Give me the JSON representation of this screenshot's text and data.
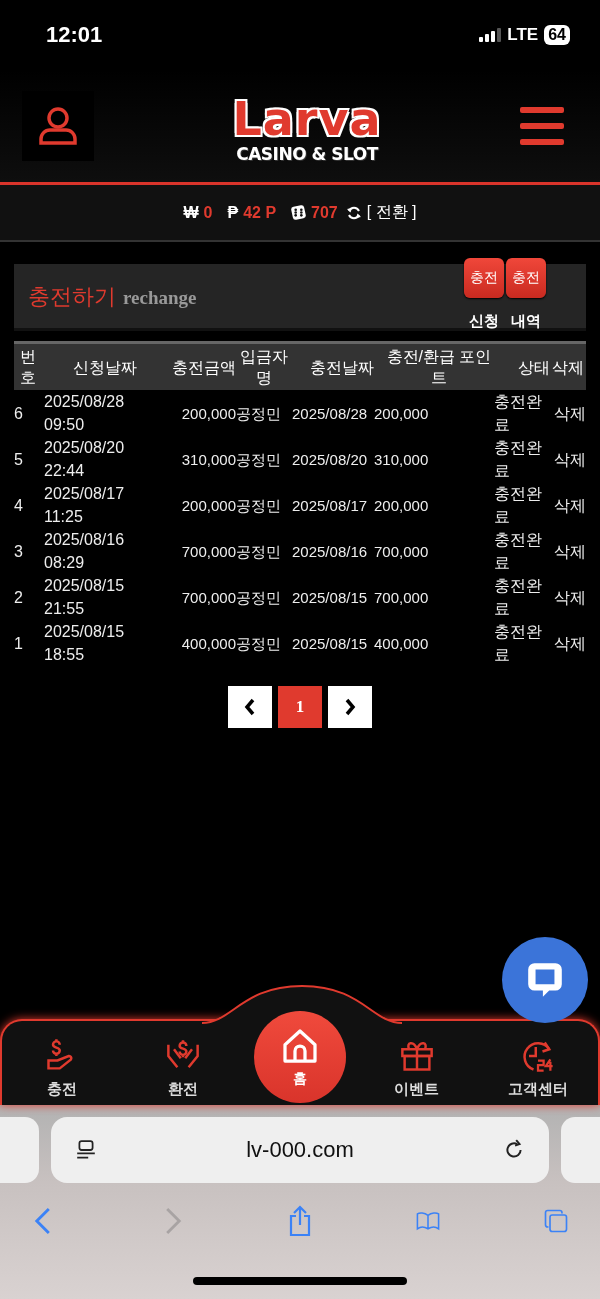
{
  "status_bar": {
    "time": "12:01",
    "network": "LTE",
    "battery": "64"
  },
  "header": {
    "logo": {
      "title": "Larva",
      "subtitle": "CASINO & SLOT"
    }
  },
  "balance": {
    "currency_symbol": "₩",
    "money": "0",
    "point_symbol": "₱",
    "points": "42 P",
    "dice": "707",
    "convert": "[ 전환 ]"
  },
  "section": {
    "title": "충전하기",
    "subtitle": "rechange",
    "buttons": [
      {
        "label": "충전",
        "caption": "신청"
      },
      {
        "label": "충전",
        "caption": "내역"
      }
    ]
  },
  "table": {
    "columns": [
      "번호",
      "신청날짜",
      "충전금액",
      "입금자명",
      "충전날짜",
      "충전/환급 포인트",
      "상태",
      "삭제"
    ],
    "rows": [
      {
        "no": "6",
        "requested": "2025/08/28 09:50",
        "amount": "200,000",
        "depositor": "공정민",
        "charged": "2025/08/28",
        "points": "200,000",
        "status": "충전완료",
        "delete": "삭제"
      },
      {
        "no": "5",
        "requested": "2025/08/20 22:44",
        "amount": "310,000",
        "depositor": "공정민",
        "charged": "2025/08/20",
        "points": "310,000",
        "status": "충전완료",
        "delete": "삭제"
      },
      {
        "no": "4",
        "requested": "2025/08/17 11:25",
        "amount": "200,000",
        "depositor": "공정민",
        "charged": "2025/08/17",
        "points": "200,000",
        "status": "충전완료",
        "delete": "삭제"
      },
      {
        "no": "3",
        "requested": "2025/08/16 08:29",
        "amount": "700,000",
        "depositor": "공정민",
        "charged": "2025/08/16",
        "points": "700,000",
        "status": "충전완료",
        "delete": "삭제"
      },
      {
        "no": "2",
        "requested": "2025/08/15 21:55",
        "amount": "700,000",
        "depositor": "공정민",
        "charged": "2025/08/15",
        "points": "700,000",
        "status": "충전완료",
        "delete": "삭제"
      },
      {
        "no": "1",
        "requested": "2025/08/15 18:55",
        "amount": "400,000",
        "depositor": "공정민",
        "charged": "2025/08/15",
        "points": "400,000",
        "status": "충전완료",
        "delete": "삭제"
      }
    ]
  },
  "pagination": {
    "pages": [
      {
        "label": "1",
        "selected": true
      }
    ]
  },
  "bottom_nav": [
    {
      "kind": "deposit",
      "label": "충전",
      "selected": false
    },
    {
      "kind": "withdraw",
      "label": "환전",
      "selected": false
    },
    {
      "kind": "home",
      "label": "홈",
      "selected": true
    },
    {
      "kind": "event",
      "label": "이벤트",
      "selected": false
    },
    {
      "kind": "support",
      "label": "고객센터",
      "selected": false
    }
  ],
  "browser": {
    "url": "lv-000.com"
  }
}
